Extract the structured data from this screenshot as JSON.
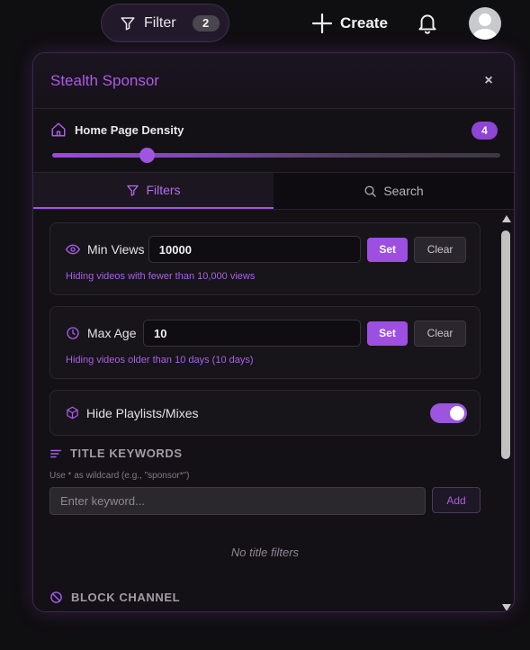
{
  "topbar": {
    "filter_label": "Filter",
    "filter_count": "2",
    "create_label": "Create"
  },
  "panel": {
    "title": "Stealth Sponsor",
    "close_glyph": "×",
    "density": {
      "label": "Home Page Density",
      "value": "4",
      "slider_fraction": 0.21
    },
    "tabs": [
      {
        "label": "Filters",
        "icon": "funnel-icon",
        "active": true
      },
      {
        "label": "Search",
        "icon": "search-icon",
        "active": false
      }
    ],
    "min_views": {
      "label": "Min Views",
      "value": "10000",
      "set_label": "Set",
      "clear_label": "Clear",
      "hint": "Hiding videos with fewer than 10,000 views"
    },
    "max_age": {
      "label": "Max Age",
      "value": "10",
      "set_label": "Set",
      "clear_label": "Clear",
      "hint": "Hiding videos older than 10 days (10 days)"
    },
    "playlists": {
      "label": "Hide Playlists/Mixes",
      "enabled": true
    },
    "title_keywords": {
      "heading": "TITLE KEYWORDS",
      "hint": "Use * as wildcard (e.g., \"sponsor*\")",
      "placeholder": "Enter keyword...",
      "add_label": "Add",
      "empty_text": "No title filters"
    },
    "block_channel": {
      "heading": "BLOCK CHANNEL"
    }
  },
  "colors": {
    "accent": "#9c4fe0",
    "background": "#0f0e10",
    "panel": "#131016"
  }
}
